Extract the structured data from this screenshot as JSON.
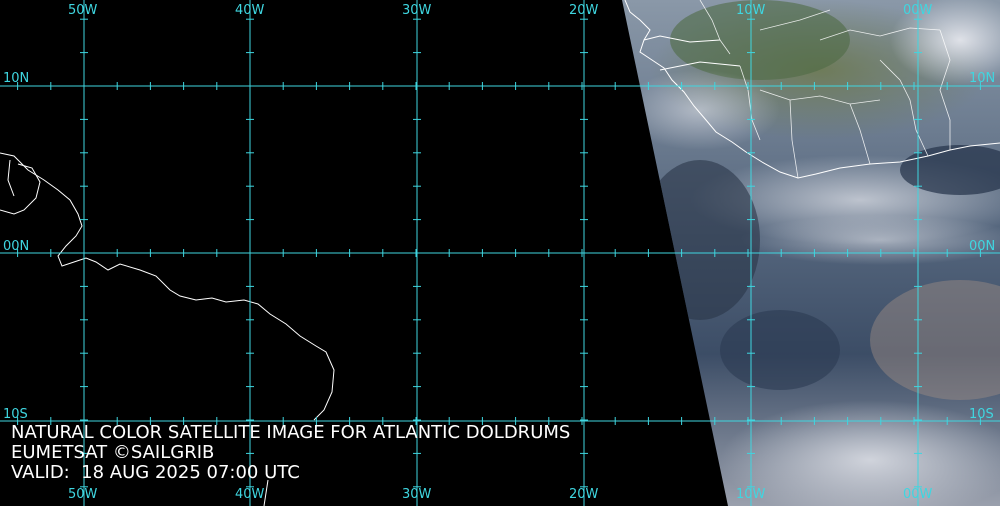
{
  "map": {
    "caption": {
      "line1": "NATURAL COLOR SATELLITE IMAGE FOR ATLANTIC DOLDRUMS",
      "line2": "EUMETSAT ©SAILGRIB",
      "line3": "VALID:  18 AUG 2025 07:00 UTC"
    },
    "longitude_labels": [
      "50W",
      "40W",
      "30W",
      "20W",
      "10W",
      "00W"
    ],
    "latitude_labels": [
      "10N",
      "00N",
      "10S"
    ],
    "colors": {
      "grid": "#3fd6e0",
      "coastline": "#ffffff",
      "background": "#000000",
      "cloud": "#c9ccd6",
      "ocean": "#1c2a3c",
      "land": "#5f6b4e"
    }
  }
}
